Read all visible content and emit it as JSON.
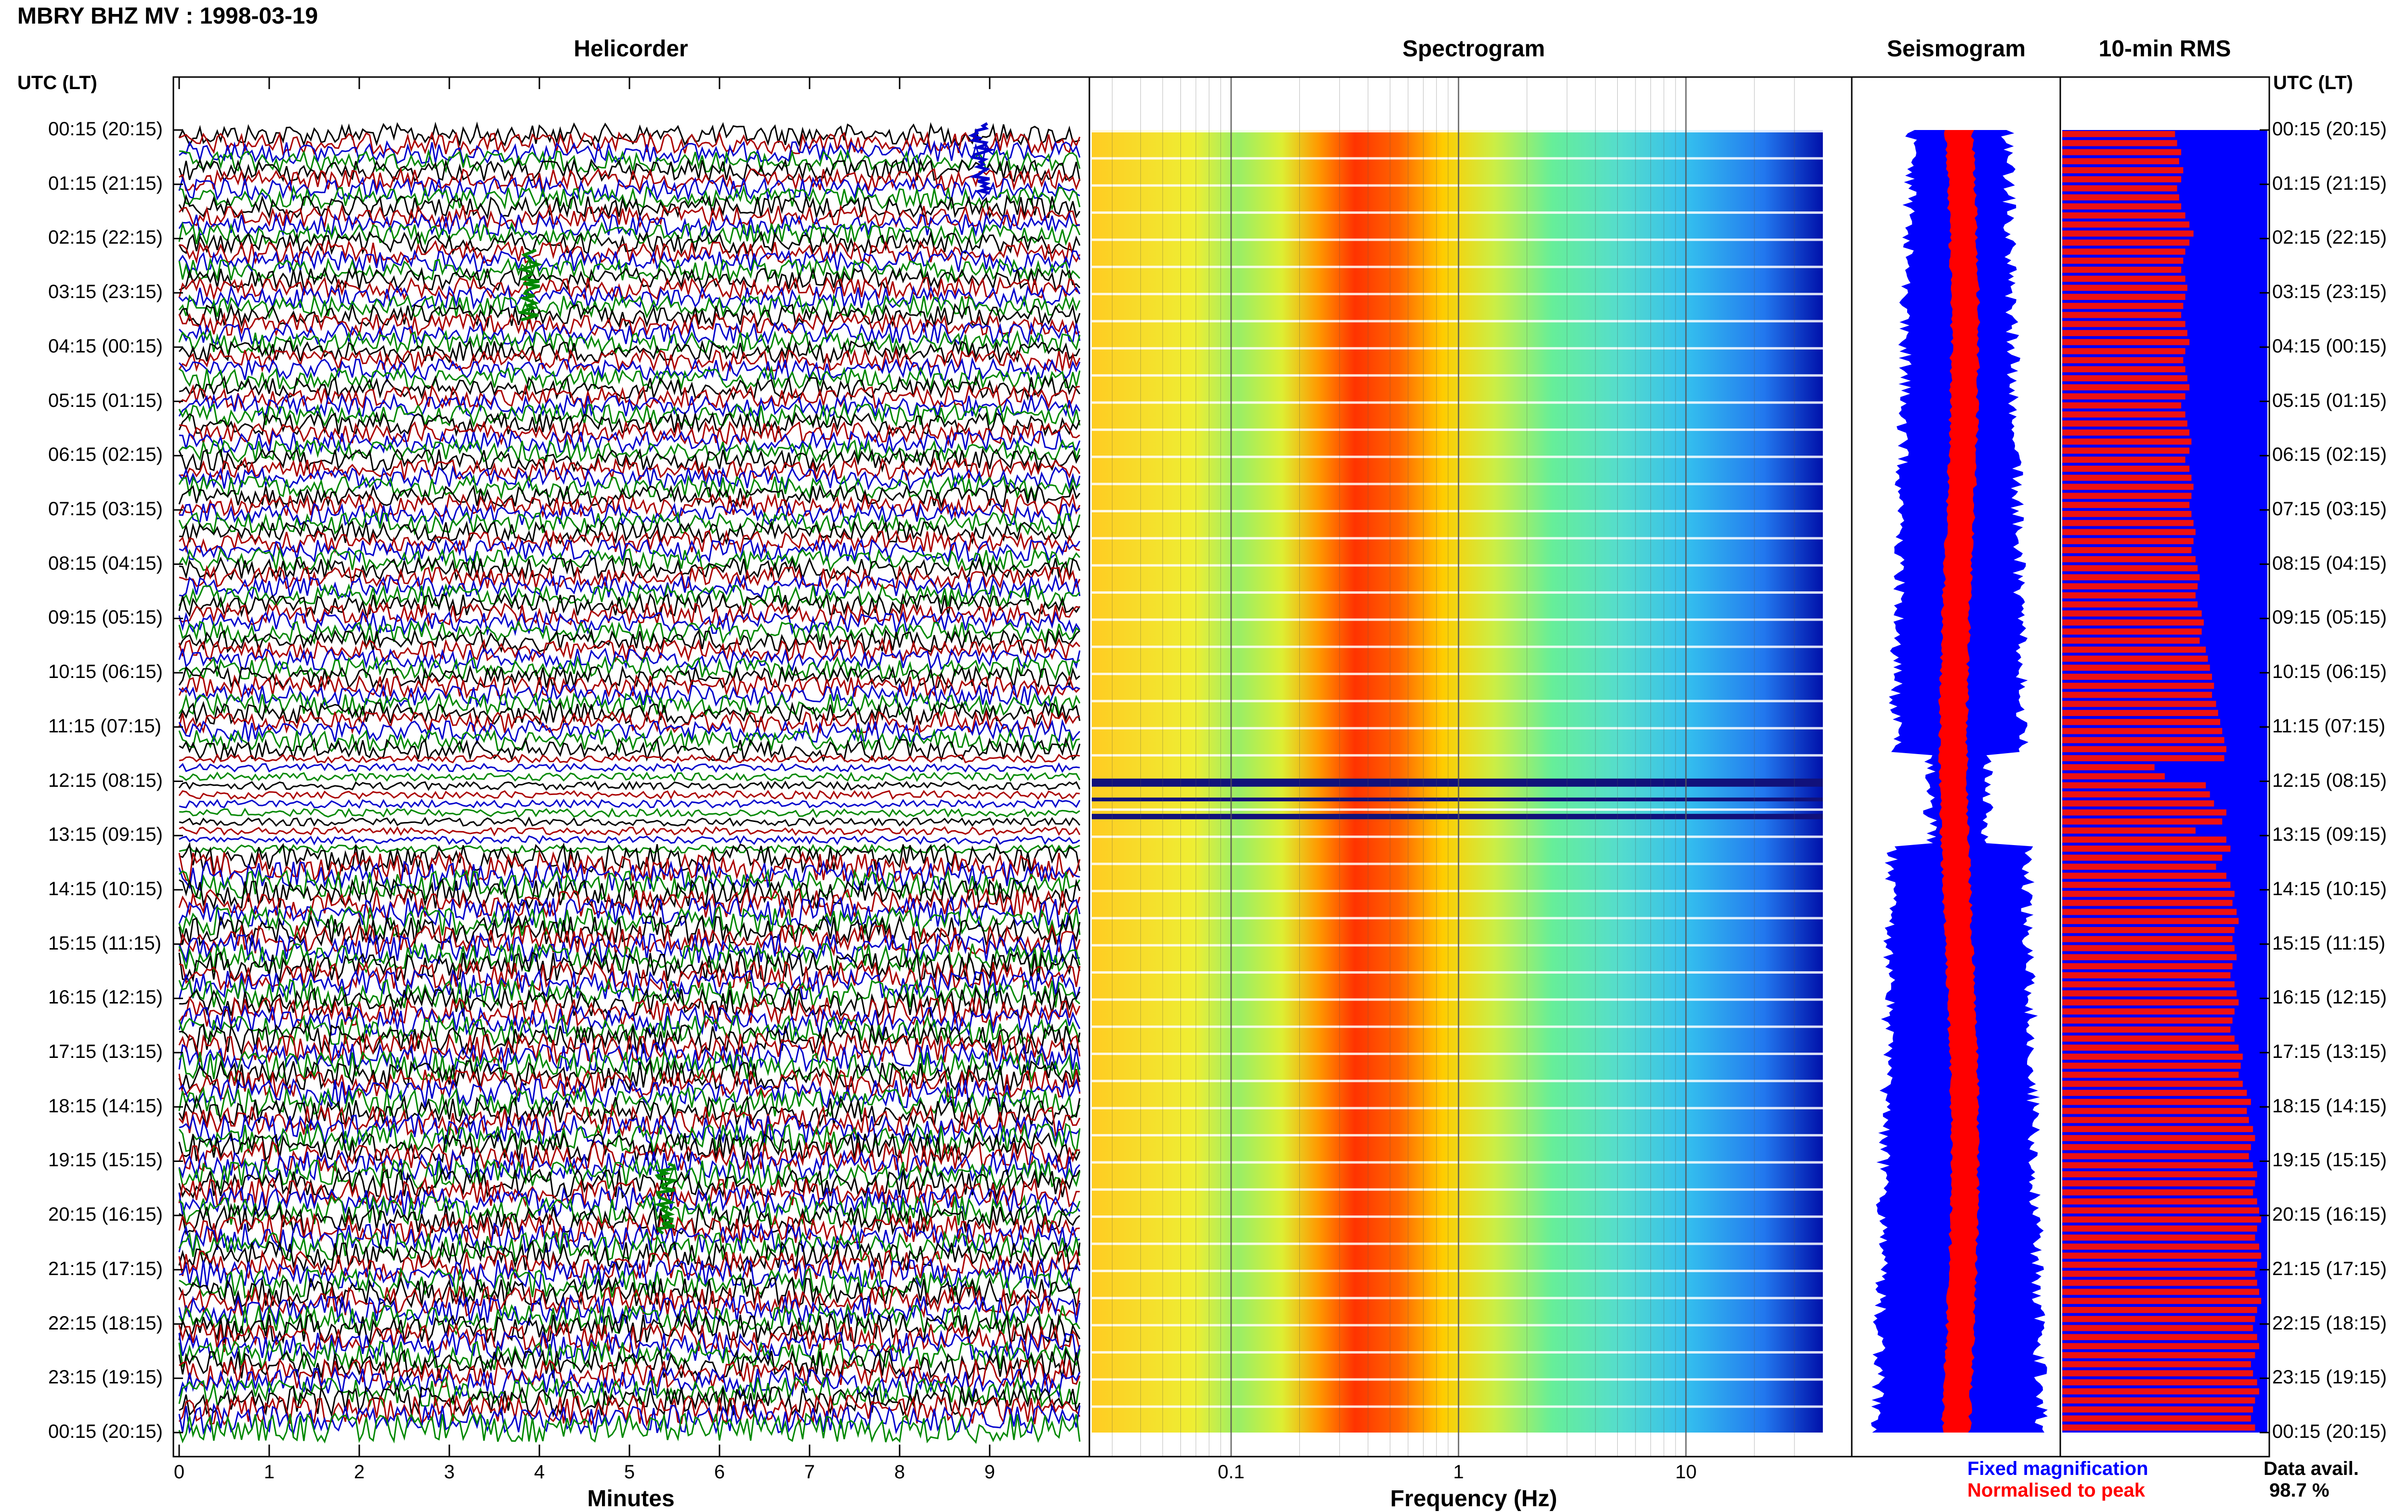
{
  "title": "MBRY BHZ MV : 1998-03-19",
  "panels": {
    "helicorder": "Helicorder",
    "spectrogram": "Spectrogram",
    "seismogram": "Seismogram",
    "rms": "10-min RMS"
  },
  "axis_label_left": "UTC (LT)",
  "axis_label_right": "UTC (LT)",
  "hour_labels": [
    "00:15 (20:15)",
    "01:15 (21:15)",
    "02:15 (22:15)",
    "03:15 (23:15)",
    "04:15 (00:15)",
    "05:15 (01:15)",
    "06:15 (02:15)",
    "07:15 (03:15)",
    "08:15 (04:15)",
    "09:15 (05:15)",
    "10:15 (06:15)",
    "11:15 (07:15)",
    "12:15 (08:15)",
    "13:15 (09:15)",
    "14:15 (10:15)",
    "15:15 (11:15)",
    "16:15 (12:15)",
    "17:15 (13:15)",
    "18:15 (14:15)",
    "19:15 (15:15)",
    "20:15 (16:15)",
    "21:15 (17:15)",
    "22:15 (18:15)",
    "23:15 (19:15)",
    "00:15 (20:15)"
  ],
  "legend": {
    "fixed": "Fixed magnification",
    "normalised": "Normalised to peak"
  },
  "data_avail": {
    "label": "Data avail.",
    "value": "98.7 %"
  },
  "colors": {
    "helicorder_traces": [
      "#000000",
      "#aa0000",
      "#0000cc",
      "#008800"
    ],
    "fixed": "#0000ff",
    "normalised": "#ff0000",
    "rms_bg": "#0000ff",
    "rms_bar": "#ee1111"
  },
  "chart_data": [
    {
      "type": "line",
      "name": "helicorder",
      "xlabel": "Minutes",
      "x_ticks": [
        0,
        1,
        2,
        3,
        4,
        5,
        6,
        7,
        8,
        9
      ],
      "xlim": [
        0,
        10
      ],
      "rows": 144,
      "events": [
        {
          "minute": 8.9,
          "time_utc": "00:45"
        },
        {
          "minute": 3.9,
          "time_utc": "03:05"
        },
        {
          "minute": 5.4,
          "time_utc": "19:55"
        }
      ],
      "data_gap_utc": [
        "11:25",
        "13:10"
      ]
    },
    {
      "type": "heatmap",
      "name": "spectrogram",
      "xlabel": "Frequency (Hz)",
      "x_scale": "log",
      "x_ticks": [
        0.1,
        1,
        10
      ],
      "x_tick_labels": [
        "0.1",
        "1",
        "10"
      ],
      "xlim": [
        0.025,
        40
      ],
      "peak_band_hz": [
        0.2,
        0.5
      ],
      "gap_utc": [
        "12:10",
        "13:05"
      ]
    },
    {
      "type": "area",
      "name": "seismogram",
      "series": [
        "Fixed magnification",
        "Normalised to peak"
      ]
    },
    {
      "type": "bar",
      "name": "10-min RMS",
      "bins": 144,
      "relative_values": [
        0.55,
        0.56,
        0.58,
        0.57,
        0.59,
        0.58,
        0.56,
        0.57,
        0.58,
        0.6,
        0.62,
        0.64,
        0.62,
        0.6,
        0.59,
        0.58,
        0.6,
        0.61,
        0.6,
        0.59,
        0.58,
        0.6,
        0.61,
        0.62,
        0.6,
        0.59,
        0.6,
        0.61,
        0.62,
        0.6,
        0.58,
        0.6,
        0.61,
        0.62,
        0.63,
        0.62,
        0.6,
        0.62,
        0.63,
        0.64,
        0.63,
        0.62,
        0.63,
        0.64,
        0.65,
        0.64,
        0.63,
        0.65,
        0.66,
        0.67,
        0.66,
        0.65,
        0.66,
        0.68,
        0.69,
        0.68,
        0.67,
        0.7,
        0.71,
        0.72,
        0.73,
        0.74,
        0.73,
        0.75,
        0.76,
        0.77,
        0.78,
        0.79,
        0.8,
        0.79,
        0.45,
        0.5,
        0.7,
        0.72,
        0.74,
        0.8,
        0.78,
        0.65,
        0.8,
        0.82,
        0.78,
        0.75,
        0.8,
        0.82,
        0.84,
        0.83,
        0.85,
        0.86,
        0.84,
        0.83,
        0.84,
        0.85,
        0.83,
        0.82,
        0.84,
        0.85,
        0.86,
        0.84,
        0.83,
        0.82,
        0.84,
        0.86,
        0.88,
        0.87,
        0.86,
        0.88,
        0.9,
        0.92,
        0.9,
        0.91,
        0.93,
        0.94,
        0.92,
        0.91,
        0.93,
        0.95,
        0.94,
        0.93,
        0.95,
        0.96,
        0.97,
        0.95,
        0.94,
        0.96,
        0.97,
        0.95,
        0.94,
        0.95,
        0.96,
        0.97,
        0.95,
        0.94,
        0.93,
        0.95,
        0.96,
        0.94,
        0.92,
        0.93,
        0.95,
        0.96,
        0.94,
        0.93,
        0.92,
        0.94
      ]
    }
  ]
}
